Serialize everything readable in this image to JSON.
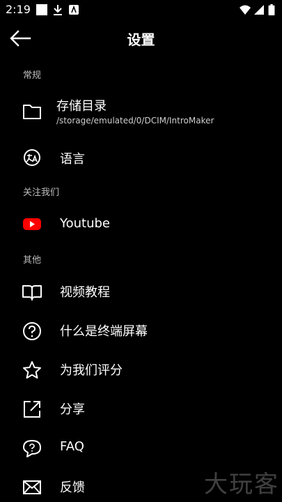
{
  "status": {
    "time": "2:19"
  },
  "appbar": {
    "title": "设置"
  },
  "sections": {
    "general": "常规",
    "follow": "关注我们",
    "other": "其他"
  },
  "items": {
    "storage": {
      "label": "存储目录",
      "path": "/storage/emulated/0/DCIM/IntroMaker"
    },
    "language": {
      "label": "语言"
    },
    "youtube": {
      "label": "Youtube"
    },
    "tutorial": {
      "label": "视频教程"
    },
    "endscreen": {
      "label": "什么是终端屏幕"
    },
    "rate": {
      "label": "为我们评分"
    },
    "share": {
      "label": "分享"
    },
    "faq": {
      "label": "FAQ"
    },
    "feedback": {
      "label": "反馈"
    }
  },
  "watermark": "大玩客",
  "colors": {
    "background": "#000000",
    "youtube_red": "#ff0000"
  }
}
